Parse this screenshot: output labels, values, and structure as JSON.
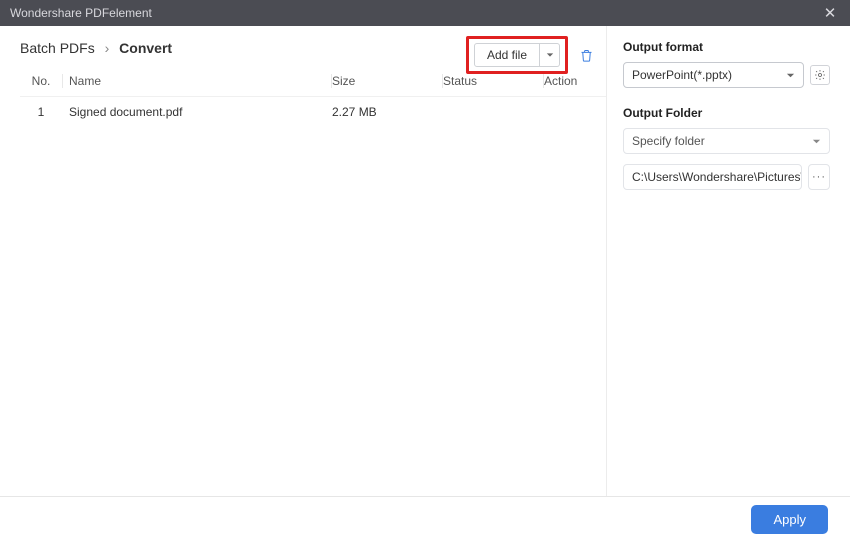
{
  "titlebar": {
    "title": "Wondershare PDFelement"
  },
  "breadcrumb": {
    "parent": "Batch PDFs",
    "current": "Convert"
  },
  "toolbar": {
    "add_file": "Add file"
  },
  "table": {
    "headers": {
      "no": "No.",
      "name": "Name",
      "size": "Size",
      "status": "Status",
      "action": "Action"
    },
    "rows": [
      {
        "no": "1",
        "name": "Signed document.pdf",
        "size": "2.27 MB",
        "status": "",
        "action": ""
      }
    ]
  },
  "right": {
    "output_format_label": "Output format",
    "output_format_value": "PowerPoint(*.pptx)",
    "output_folder_label": "Output Folder",
    "specify_folder": "Specify folder",
    "folder_path": "C:\\Users\\Wondershare\\Pictures\\TLDR T",
    "more": "···"
  },
  "footer": {
    "apply": "Apply"
  }
}
